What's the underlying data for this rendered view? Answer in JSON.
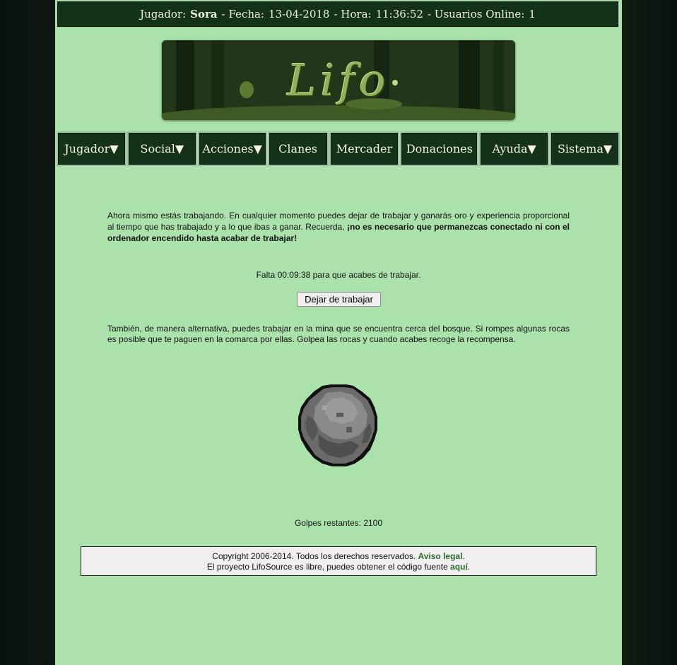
{
  "header": {
    "player_label": "Jugador:",
    "player_name": "Sora",
    "date_label": "- Fecha:",
    "date": "13-04-2018",
    "time_label": "- Hora:",
    "time": "11:36:52",
    "online_label": "- Usuarios Online:",
    "online": "1"
  },
  "banner": {
    "logo_text": "Lifo"
  },
  "nav": [
    {
      "label": "Jugador▼"
    },
    {
      "label": "Social▼"
    },
    {
      "label": "Acciones▼"
    },
    {
      "label": "Clanes"
    },
    {
      "label": "Mercader"
    },
    {
      "label": "Donaciones"
    },
    {
      "label": "Ayuda▼"
    },
    {
      "label": "Sistema▼"
    }
  ],
  "work": {
    "intro": "Ahora mismo estás trabajando. En cualquier momento puedes dejar de trabajar y ganarás oro y experiencia proporcional al tiempo que has trabajado y a lo que ibas a ganar. Recuerda, ",
    "intro_bold": "¡no es necesario que permanezcas conectado ni con el ordenador encendido hasta acabar de trabajar!",
    "remaining": "Falta 00:09:38 para que acabes de trabajar.",
    "stop_button": "Dejar de trabajar",
    "mine_text": "También, de manera alternativa, puedes trabajar en la mina que se encuentra cerca del bosque. Si rompes algunas rocas es posible que te paguen en la comarca por ellas. Golpea las rocas y cuando acabes recoge la recompensa.",
    "hits_left": "Golpes restantes: 2100"
  },
  "footer": {
    "copyright": "Copyright 2006-2014. Todos los derechos reservados. ",
    "legal_link": "Aviso legal",
    "period": ".",
    "source_text": "El proyecto LifoSource es libre, puedes obtener el código fuente ",
    "source_link": "aquí",
    "period2": "."
  },
  "colors": {
    "page_bg": "#abe2ab",
    "bar_bg": "#143219",
    "link": "#2e6b2e"
  }
}
